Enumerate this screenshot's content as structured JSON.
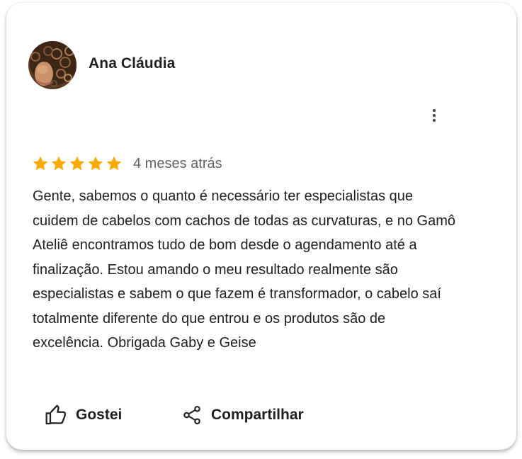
{
  "review": {
    "author": "Ana Cláudia",
    "rating": 5,
    "rating_max": 5,
    "date": "4 meses atrás",
    "text": "Gente, sabemos o quanto é necessário ter especialistas que cuidem de cabelos com cachos de todas as curvaturas, e no Gamô Ateliê encontramos tudo de bom desde o agendamento até a finalização. Estou amando o meu resultado realmente são especialistas e sabem o que fazem é transformador, o cabelo saí totalmente diferente do que entrou e os produtos são de excelência. Obrigada Gaby e Geise"
  },
  "actions": {
    "like_label": "Gostei",
    "share_label": "Compartilhar"
  },
  "icons": {
    "more": "more-vert-icon",
    "star": "star-icon",
    "like": "thumb-up-icon",
    "share": "share-icon"
  },
  "colors": {
    "star": "#F9AB00",
    "text": "#202124",
    "secondary_text": "#5F6368"
  }
}
